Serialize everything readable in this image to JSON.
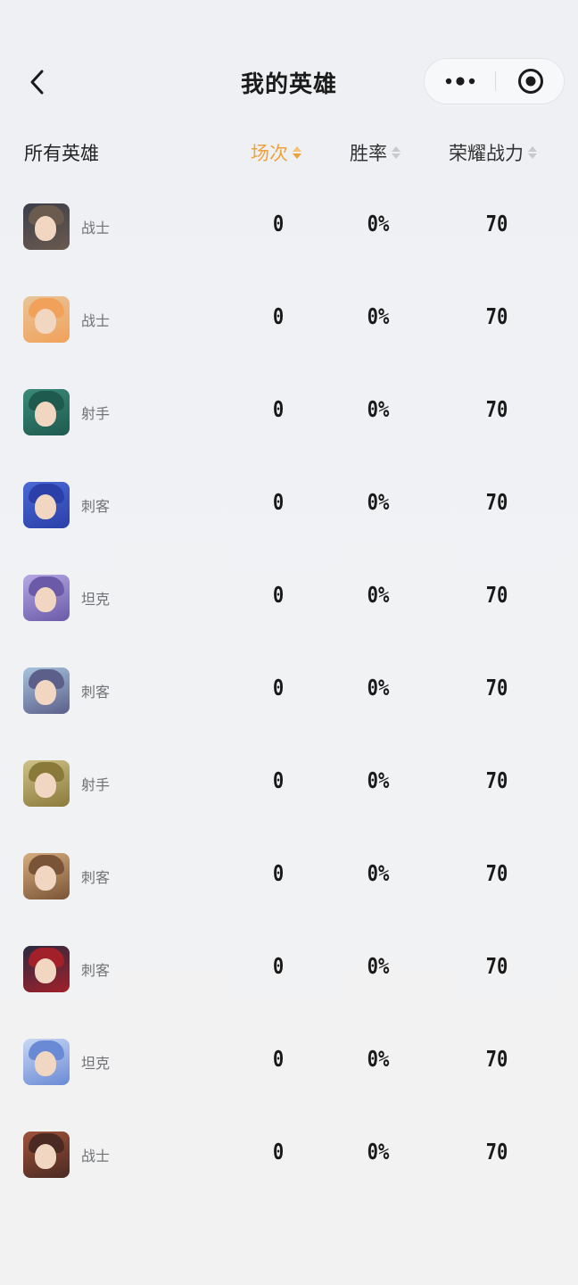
{
  "nav": {
    "title": "我的英雄",
    "back_icon": "chevron-left-icon",
    "more_icon": "more-dots-icon",
    "close_icon": "target-circle-icon"
  },
  "header": {
    "all_heroes": "所有英雄",
    "col_games": "场次",
    "col_winrate": "胜率",
    "col_power": "荣耀战力",
    "active_sort": "场次",
    "active_color": "#f0a23a"
  },
  "heroes": [
    {
      "role": "战士",
      "games": "0",
      "winrate": "0%",
      "power": "70",
      "avatar_colors": [
        "#6b5a4e",
        "#3b3e4c"
      ]
    },
    {
      "role": "战士",
      "games": "0",
      "winrate": "0%",
      "power": "70",
      "avatar_colors": [
        "#f2a15a",
        "#e7c59a"
      ]
    },
    {
      "role": "射手",
      "games": "0",
      "winrate": "0%",
      "power": "70",
      "avatar_colors": [
        "#1f5a4f",
        "#3a8a7a"
      ]
    },
    {
      "role": "刺客",
      "games": "0",
      "winrate": "0%",
      "power": "70",
      "avatar_colors": [
        "#2b3fa8",
        "#4a6ad6"
      ]
    },
    {
      "role": "坦克",
      "games": "0",
      "winrate": "0%",
      "power": "70",
      "avatar_colors": [
        "#6a5aa8",
        "#b7a8e4"
      ]
    },
    {
      "role": "刺客",
      "games": "0",
      "winrate": "0%",
      "power": "70",
      "avatar_colors": [
        "#5c5f8a",
        "#a7c4dc"
      ]
    },
    {
      "role": "射手",
      "games": "0",
      "winrate": "0%",
      "power": "70",
      "avatar_colors": [
        "#8a7a3a",
        "#cfc28a"
      ]
    },
    {
      "role": "刺客",
      "games": "0",
      "winrate": "0%",
      "power": "70",
      "avatar_colors": [
        "#7a5436",
        "#d6ad7e"
      ]
    },
    {
      "role": "刺客",
      "games": "0",
      "winrate": "0%",
      "power": "70",
      "avatar_colors": [
        "#a2202a",
        "#2a2a40"
      ]
    },
    {
      "role": "坦克",
      "games": "0",
      "winrate": "0%",
      "power": "70",
      "avatar_colors": [
        "#6a8ad6",
        "#c9d8f2"
      ]
    },
    {
      "role": "战士",
      "games": "0",
      "winrate": "0%",
      "power": "70",
      "avatar_colors": [
        "#4a2a22",
        "#a0523a"
      ]
    }
  ]
}
